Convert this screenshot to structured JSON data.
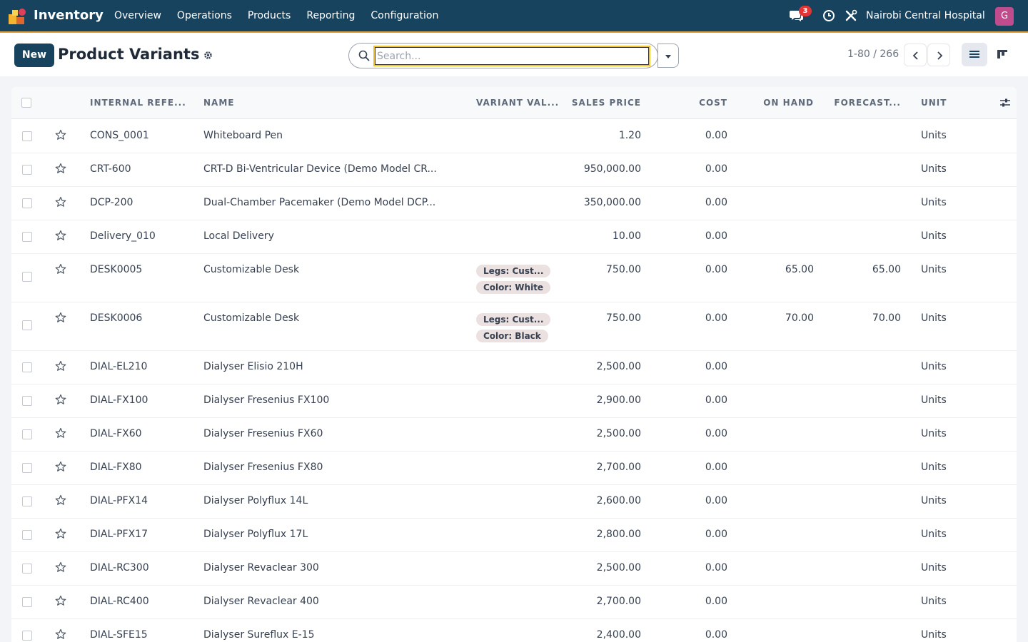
{
  "navbar": {
    "app_name": "Inventory",
    "menu": [
      "Overview",
      "Operations",
      "Products",
      "Reporting",
      "Configuration"
    ],
    "chat_badge": "3",
    "company": "Nairobi Central Hospital",
    "user_initial": "G",
    "colors": {
      "bg": "#18435f",
      "accent": "#e2a13b",
      "avatar": "#c04c8d",
      "badge": "#e23636"
    }
  },
  "control": {
    "new_label": "New",
    "title": "Product Variants",
    "search_placeholder": "Search...",
    "pager": "1-80 / 266"
  },
  "table": {
    "headers": {
      "ref": "INTERNAL REFE...",
      "name": "NAME",
      "variant": "VARIANT VAL...",
      "price": "SALES PRICE",
      "cost": "COST",
      "onhand": "ON HAND",
      "forecast": "FORECAST...",
      "unit": "UNIT"
    },
    "rows": [
      {
        "ref": "CONS_0001",
        "name": "Whiteboard Pen",
        "tags": [],
        "price": "1.20",
        "cost": "0.00",
        "onhand": "",
        "forecast": "",
        "unit": "Units"
      },
      {
        "ref": "CRT-600",
        "name": "CRT-D Bi-Ventricular Device (Demo Model CR...",
        "tags": [],
        "price": "950,000.00",
        "cost": "0.00",
        "onhand": "",
        "forecast": "",
        "unit": "Units"
      },
      {
        "ref": "DCP-200",
        "name": "Dual-Chamber Pacemaker (Demo Model DCP...",
        "tags": [],
        "price": "350,000.00",
        "cost": "0.00",
        "onhand": "",
        "forecast": "",
        "unit": "Units"
      },
      {
        "ref": "Delivery_010",
        "name": "Local Delivery",
        "tags": [],
        "price": "10.00",
        "cost": "0.00",
        "onhand": "",
        "forecast": "",
        "unit": "Units"
      },
      {
        "ref": "DESK0005",
        "name": "Customizable Desk",
        "tags": [
          "Legs: Cust...",
          "Color: White"
        ],
        "price": "750.00",
        "cost": "0.00",
        "onhand": "65.00",
        "forecast": "65.00",
        "unit": "Units"
      },
      {
        "ref": "DESK0006",
        "name": "Customizable Desk",
        "tags": [
          "Legs: Cust...",
          "Color: Black"
        ],
        "price": "750.00",
        "cost": "0.00",
        "onhand": "70.00",
        "forecast": "70.00",
        "unit": "Units"
      },
      {
        "ref": "DIAL-EL210",
        "name": "Dialyser Elisio 210H",
        "tags": [],
        "price": "2,500.00",
        "cost": "0.00",
        "onhand": "",
        "forecast": "",
        "unit": "Units"
      },
      {
        "ref": "DIAL-FX100",
        "name": "Dialyser Fresenius FX100",
        "tags": [],
        "price": "2,900.00",
        "cost": "0.00",
        "onhand": "",
        "forecast": "",
        "unit": "Units"
      },
      {
        "ref": "DIAL-FX60",
        "name": "Dialyser Fresenius FX60",
        "tags": [],
        "price": "2,500.00",
        "cost": "0.00",
        "onhand": "",
        "forecast": "",
        "unit": "Units"
      },
      {
        "ref": "DIAL-FX80",
        "name": "Dialyser Fresenius FX80",
        "tags": [],
        "price": "2,700.00",
        "cost": "0.00",
        "onhand": "",
        "forecast": "",
        "unit": "Units"
      },
      {
        "ref": "DIAL-PFX14",
        "name": "Dialyser Polyflux 14L",
        "tags": [],
        "price": "2,600.00",
        "cost": "0.00",
        "onhand": "",
        "forecast": "",
        "unit": "Units"
      },
      {
        "ref": "DIAL-PFX17",
        "name": "Dialyser Polyflux 17L",
        "tags": [],
        "price": "2,800.00",
        "cost": "0.00",
        "onhand": "",
        "forecast": "",
        "unit": "Units"
      },
      {
        "ref": "DIAL-RC300",
        "name": "Dialyser Revaclear 300",
        "tags": [],
        "price": "2,500.00",
        "cost": "0.00",
        "onhand": "",
        "forecast": "",
        "unit": "Units"
      },
      {
        "ref": "DIAL-RC400",
        "name": "Dialyser Revaclear 400",
        "tags": [],
        "price": "2,700.00",
        "cost": "0.00",
        "onhand": "",
        "forecast": "",
        "unit": "Units"
      },
      {
        "ref": "DIAL-SFE15",
        "name": "Dialyser Sureflux E-15",
        "tags": [],
        "price": "2,400.00",
        "cost": "0.00",
        "onhand": "",
        "forecast": "",
        "unit": "Units"
      }
    ]
  }
}
